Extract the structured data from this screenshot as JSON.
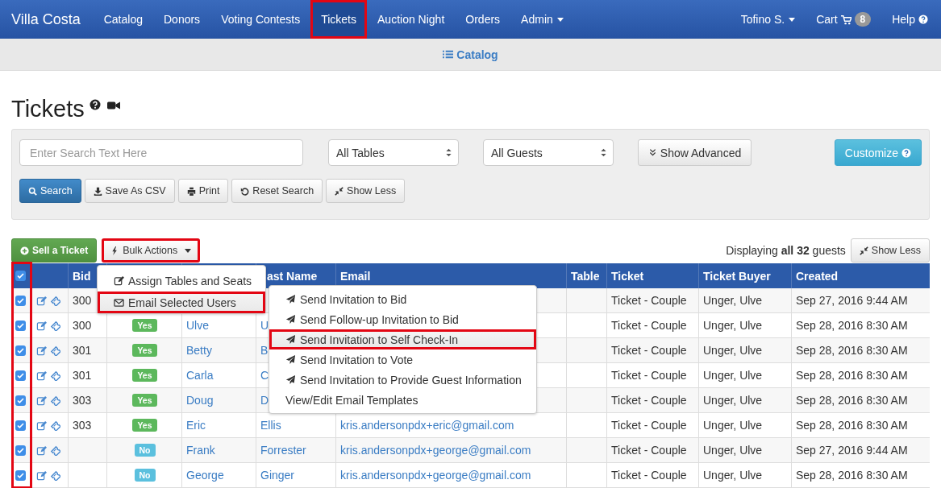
{
  "navbar": {
    "brand": "Villa Costa",
    "items": [
      {
        "label": "Catalog",
        "selected": false,
        "highlighted": false,
        "caret": false
      },
      {
        "label": "Donors",
        "selected": false,
        "highlighted": false,
        "caret": false
      },
      {
        "label": "Voting Contests",
        "selected": false,
        "highlighted": false,
        "caret": false
      },
      {
        "label": "Tickets",
        "selected": true,
        "highlighted": true,
        "caret": false
      },
      {
        "label": "Auction Night",
        "selected": false,
        "highlighted": false,
        "caret": false
      },
      {
        "label": "Orders",
        "selected": false,
        "highlighted": false,
        "caret": false
      },
      {
        "label": "Admin",
        "selected": false,
        "highlighted": false,
        "caret": true
      }
    ],
    "right_items": [
      {
        "label": "Tofino S.",
        "kind": "dropdown"
      },
      {
        "label": "Cart",
        "kind": "cart",
        "badge": "8"
      },
      {
        "label": "Help",
        "kind": "help"
      }
    ]
  },
  "subnav": {
    "link": "Catalog"
  },
  "page": {
    "title": "Tickets"
  },
  "filters": {
    "search": {
      "placeholder": "Enter Search Text Here"
    },
    "selects": [
      "All Tables",
      "All Guests"
    ],
    "show_advanced": "Show Advanced",
    "customize": "Customize",
    "buttons": [
      {
        "label": "Search",
        "kind": "primary"
      },
      {
        "label": "Save As CSV",
        "kind": "default"
      },
      {
        "label": "Print",
        "kind": "default"
      },
      {
        "label": "Reset Search",
        "kind": "default"
      },
      {
        "label": "Show Less",
        "kind": "default"
      }
    ]
  },
  "toolbar": {
    "sell": "Sell a Ticket",
    "bulk": {
      "label": "Bulk Actions",
      "highlighted": true
    },
    "summary": "Displaying **all 32** guests",
    "show_less": "Show Less"
  },
  "table": {
    "select_column_highlighted": true,
    "header_checked": true,
    "header": {
      "bid": "Bid",
      "last": "ast Name",
      "email": "Email",
      "table": "Table",
      "ticket": "Ticket",
      "buyer": "Ticket Buyer",
      "created": "Created"
    },
    "rows": [
      {
        "checked": true,
        "bid": "300",
        "ticket": "Ticket - Couple",
        "buyer": "Unger, Ulve",
        "created": "Sep 27, 2016 9:44 AM"
      },
      {
        "checked": true,
        "bid": "300",
        "badge": {
          "text": "Yes",
          "color": "#5cb85c"
        },
        "first": "Ulve",
        "last": "U",
        "ticket": "Ticket - Couple",
        "buyer": "Unger, Ulve",
        "created": "Sep 28, 2016 8:30 AM"
      },
      {
        "checked": true,
        "bid": "301",
        "badge": {
          "text": "Yes",
          "color": "#5cb85c"
        },
        "first": "Betty",
        "last": "B",
        "ticket": "Ticket - Couple",
        "buyer": "Unger, Ulve",
        "created": "Sep 28, 2016 8:30 AM"
      },
      {
        "checked": true,
        "bid": "301",
        "badge": {
          "text": "Yes",
          "color": "#5cb85c"
        },
        "first": "Carla",
        "last": "C",
        "ticket": "Ticket - Couple",
        "buyer": "Unger, Ulve",
        "created": "Sep 28, 2016 8:30 AM"
      },
      {
        "checked": true,
        "bid": "303",
        "badge": {
          "text": "Yes",
          "color": "#5cb85c"
        },
        "first": "Doug",
        "last": "D",
        "ticket": "Ticket - Couple",
        "buyer": "Unger, Ulve",
        "created": "Sep 28, 2016 8:30 AM"
      },
      {
        "checked": true,
        "bid": "303",
        "badge": {
          "text": "Yes",
          "color": "#5cb85c"
        },
        "first": "Eric",
        "last": "Ellis",
        "email": "kris.andersonpdx+eric@gmail.com",
        "ticket": "Ticket - Couple",
        "buyer": "Unger, Ulve",
        "created": "Sep 28, 2016 8:30 AM"
      },
      {
        "checked": true,
        "badge": {
          "text": "No",
          "color": "#5bc0de"
        },
        "first": "Frank",
        "last": "Forrester",
        "email": "kris.andersonpdx+george@gmail.com",
        "ticket": "Ticket - Couple",
        "buyer": "Unger, Ulve",
        "created": "Sep 27, 2016 9:44 AM"
      },
      {
        "checked": true,
        "badge": {
          "text": "No",
          "color": "#5bc0de"
        },
        "first": "George",
        "last": "Ginger",
        "email": "kris.andersonpdx+george@gmail.com",
        "ticket": "Ticket - Couple",
        "buyer": "Unger, Ulve",
        "created": "Sep 28, 2016 8:30 AM"
      }
    ]
  },
  "bulk_menu": {
    "items": [
      {
        "label": "Assign Tables and Seats",
        "kind": "edit",
        "highlighted": false
      },
      {
        "label": "Email Selected Users",
        "kind": "email",
        "highlighted": true
      }
    ]
  },
  "email_submenu": {
    "items": [
      {
        "label": "Send Invitation to Bid",
        "kind": "send",
        "highlighted": false
      },
      {
        "label": "Send Follow-up Invitation to Bid",
        "kind": "send",
        "highlighted": false
      },
      {
        "label": "Send Invitation to Self Check-In",
        "kind": "send",
        "highlighted": true
      },
      {
        "label": "Send Invitation to Vote",
        "kind": "send",
        "highlighted": false
      },
      {
        "label": "Send Invitation to Provide Guest Information",
        "kind": "send",
        "highlighted": false
      },
      {
        "label": "View/Edit Email Templates",
        "kind": "link",
        "highlighted": false
      }
    ]
  }
}
